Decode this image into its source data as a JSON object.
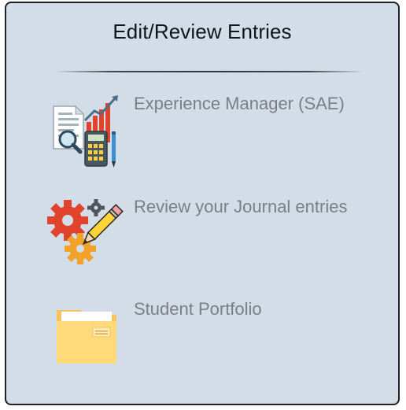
{
  "panel": {
    "title": "Edit/Review Entries",
    "items": [
      {
        "label": "Experience Manager (SAE)",
        "icon": "report-calculator-icon"
      },
      {
        "label": "Review your Journal entries",
        "icon": "gears-pencil-icon"
      },
      {
        "label": "Student Portfolio",
        "icon": "folder-icon"
      }
    ]
  },
  "colors": {
    "panel_background": "#d2dde8",
    "label_text": "#7b7f84",
    "title_text": "#111418"
  }
}
